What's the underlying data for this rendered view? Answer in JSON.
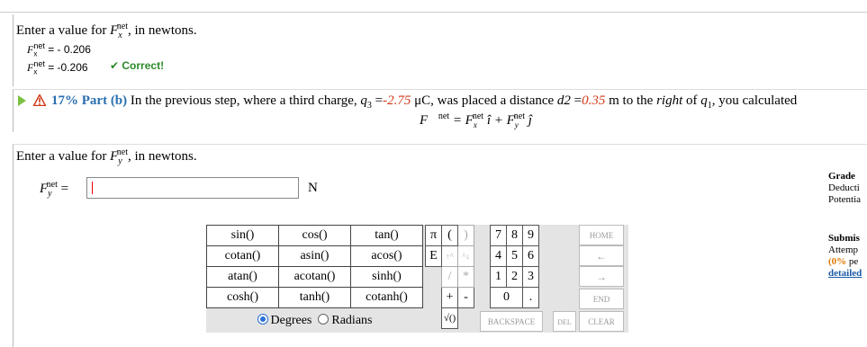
{
  "top_fragment": "· · · · ·",
  "part_a": {
    "prompt_prefix": "Enter a value for ",
    "symbol": "F",
    "superscript": "net",
    "subscript": "x",
    "prompt_suffix": ", in newtons.",
    "answer_line1_lhs": "F",
    "answer_line1_sub": "x",
    "answer_line1_sup": "net",
    "answer_line1_value": " = - 0.206",
    "answer_line2_value": " = -0.206",
    "correct_label": "✔ Correct!"
  },
  "part_b": {
    "percent_label": "17% Part (b)",
    "text_1": "In the previous step, where a third charge, ",
    "q3": "q",
    "q3_sub": "3",
    "equals": " =",
    "q3_value": "-2.75",
    "unit_uc": " μC, was placed a distance ",
    "d2": "d2",
    "equals2": " =",
    "d2_value": "0.35",
    "text_2": " m to the ",
    "right": "right",
    "text_3": " of ",
    "q1": "q",
    "q1_sub": "1",
    "text_4": ", you calculated",
    "formula": "F⃗net = Fxnet î + Fynet ĵ",
    "prompt_prefix": "Enter a value for ",
    "prompt_symbol": "F",
    "prompt_sub": "y",
    "prompt_sup": "net",
    "prompt_suffix": ", in newtons.",
    "input_label_sym": "F",
    "input_label_sub": "y",
    "input_label_sup": "net",
    "input_label_eq": " =",
    "input_value": "",
    "unit": "N"
  },
  "calculator": {
    "functions": [
      [
        "sin()",
        "cos()",
        "tan()"
      ],
      [
        "cotan()",
        "asin()",
        "acos()"
      ],
      [
        "atan()",
        "acotan()",
        "sinh()"
      ],
      [
        "cosh()",
        "tanh()",
        "cotanh()"
      ]
    ],
    "degrees_label": "Degrees",
    "radians_label": "Radians",
    "degrees_selected": true,
    "keys": {
      "pi": "π",
      "lparen": "(",
      "rparen": ")",
      "E": "E",
      "up": "↑^",
      "down": "^↓",
      "div": "/",
      "mul": "*",
      "plus": "+",
      "minus": "-",
      "sqrt": "√()",
      "n7": "7",
      "n8": "8",
      "n9": "9",
      "n4": "4",
      "n5": "5",
      "n6": "6",
      "n1": "1",
      "n2": "2",
      "n3": "3",
      "n0": "0",
      "dot": "."
    },
    "home": "HOME",
    "left_arrow": "←",
    "right_arrow": "→",
    "end": "END",
    "backspace": "BACKSPACE",
    "del": "DEL",
    "clear": "CLEAR"
  },
  "right_panel": {
    "grade": "Grade",
    "deduct": "Deducti",
    "potential": "Potentia",
    "submis": "Submis",
    "attempt": "Attemp",
    "percent": "(0%",
    "per": " pe",
    "detailed": "detailed"
  }
}
